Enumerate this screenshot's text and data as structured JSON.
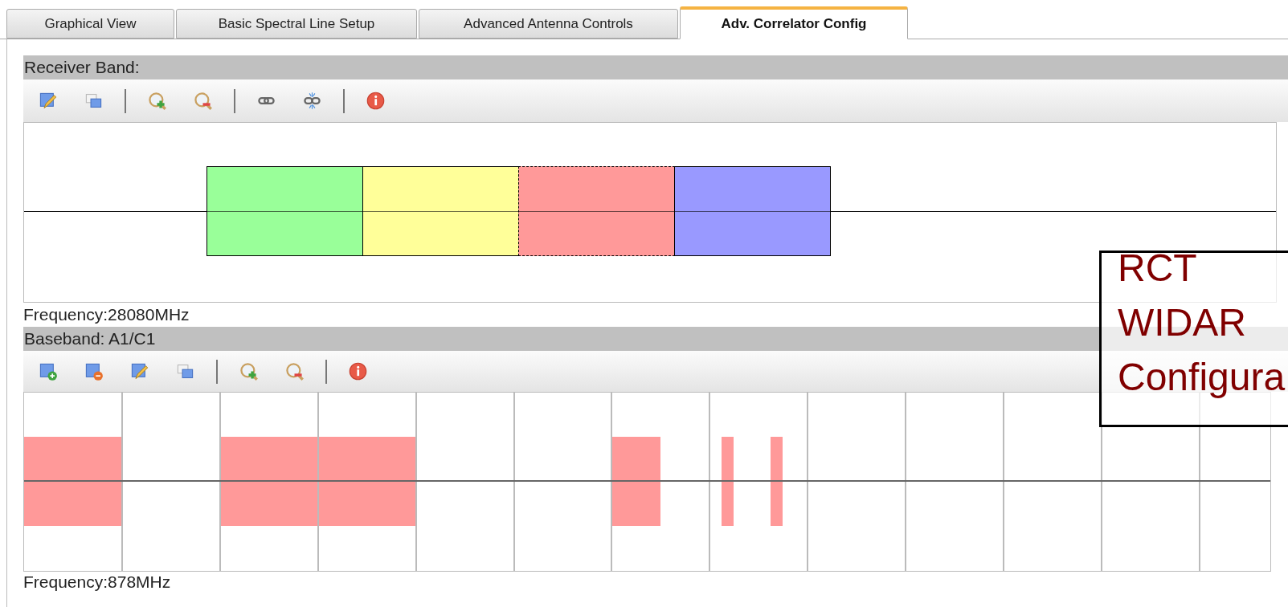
{
  "tabs": [
    {
      "label": "Graphical View",
      "selected": false
    },
    {
      "label": "Basic Spectral Line Setup",
      "selected": false
    },
    {
      "label": "Advanced Antenna Controls",
      "selected": false
    },
    {
      "label": "Adv. Correlator Config",
      "selected": true
    }
  ],
  "receiver_band": {
    "title": "Receiver Band:",
    "subbands": [
      {
        "color": "#99ff99",
        "selected": false
      },
      {
        "color": "#ffff99",
        "selected": false
      },
      {
        "color": "#ff9999",
        "selected": true
      },
      {
        "color": "#9999ff",
        "selected": false
      }
    ],
    "frequency": "Frequency:28080MHz"
  },
  "baseband": {
    "title": "Baseband: A1/C1",
    "frequency": "Frequency:878MHz"
  },
  "overlay": {
    "lines": [
      "RCT",
      "WIDAR",
      "Configura"
    ]
  }
}
